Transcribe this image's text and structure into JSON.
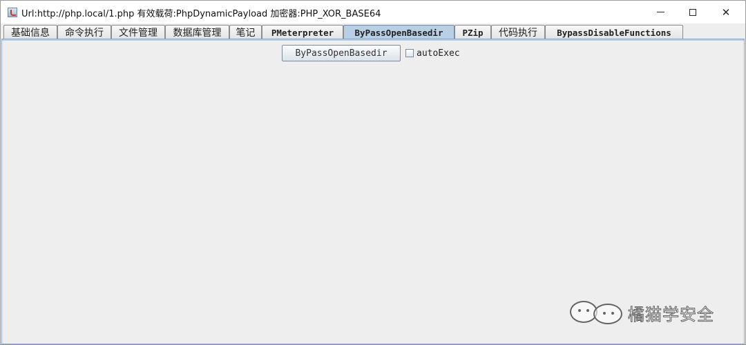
{
  "window": {
    "title": "Url:http://php.local/1.php 有效载荷:PhpDynamicPayload 加密器:PHP_XOR_BASE64",
    "minimize_label": "—",
    "maximize_label": "☐",
    "close_label": "✕"
  },
  "tabs": [
    {
      "label": "基础信息",
      "active": false
    },
    {
      "label": "命令执行",
      "active": false
    },
    {
      "label": "文件管理",
      "active": false
    },
    {
      "label": "数据库管理",
      "active": false
    },
    {
      "label": "笔记",
      "active": false
    },
    {
      "label": "PMeterpreter",
      "active": false
    },
    {
      "label": "ByPassOpenBasedir",
      "active": true
    },
    {
      "label": "PZip",
      "active": false
    },
    {
      "label": "代码执行",
      "active": false
    },
    {
      "label": "BypassDisableFunctions",
      "active": false
    }
  ],
  "panel": {
    "action_button_label": "ByPassOpenBasedir",
    "auto_exec_label": "autoExec",
    "auto_exec_checked": false
  },
  "watermark": {
    "text": "橘猫学安全"
  },
  "colors": {
    "active_tab": "#b8cfe5",
    "panel_bg": "#eeeeee",
    "border": "#8aa6c4"
  }
}
